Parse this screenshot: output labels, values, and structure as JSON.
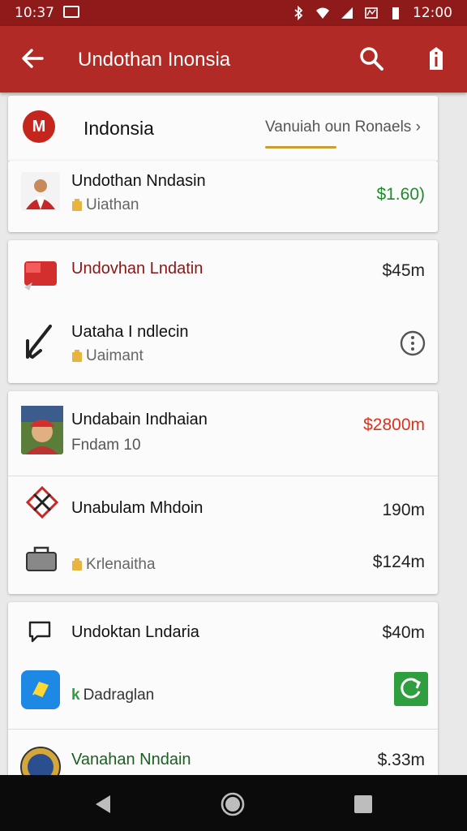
{
  "status_bar": {
    "time": "10:37",
    "clock_right": "12:00",
    "icons": [
      "image-icon",
      "bluetooth-icon",
      "wifi-icon",
      "signal-icon",
      "battery-icon"
    ]
  },
  "app_bar": {
    "title": "Undothan Inonsia",
    "icons": [
      "back-arrow-icon",
      "search-icon",
      "info-icon"
    ]
  },
  "header": {
    "logo_letter": "M",
    "name": "Indonsia",
    "tab_link": "Vanuiah oun Ronaels ›"
  },
  "cards": [
    {
      "rows": [
        {
          "title": "Undothan Nndasin",
          "subtitle": "Uiathan",
          "amount": "$1.60)",
          "amount_color": "#1f8a2e"
        }
      ]
    },
    {
      "rows": [
        {
          "title": "Undovhan Lndatin",
          "amount": "$45m",
          "title_color": "#8a1616"
        },
        {
          "title": "Uataha I ndlecin",
          "subtitle": "Uaimant",
          "action": "⋮"
        }
      ]
    },
    {
      "rows": [
        {
          "title": "Undabain Indhaian",
          "subtitle": "Fndam 10",
          "amount": "$2800m",
          "amount_color": "#d8341c"
        },
        {
          "title": "Unabulam Mhdoin",
          "amount": "190m"
        },
        {
          "subtitle": "Krlenaitha",
          "amount": "$124m"
        }
      ]
    },
    {
      "rows": [
        {
          "title": "Undoktan Lndaria",
          "amount": "$40m"
        },
        {
          "subtitle_k": "k",
          "subtitle": "Dadraglan"
        },
        {
          "title": "Vanahan Nndain",
          "amount": "$.33m",
          "title_color": "#1b5e20"
        }
      ]
    }
  ],
  "nav_bar": {
    "icons": [
      "back-triangle-icon",
      "home-circle-icon",
      "recents-square-icon"
    ]
  }
}
